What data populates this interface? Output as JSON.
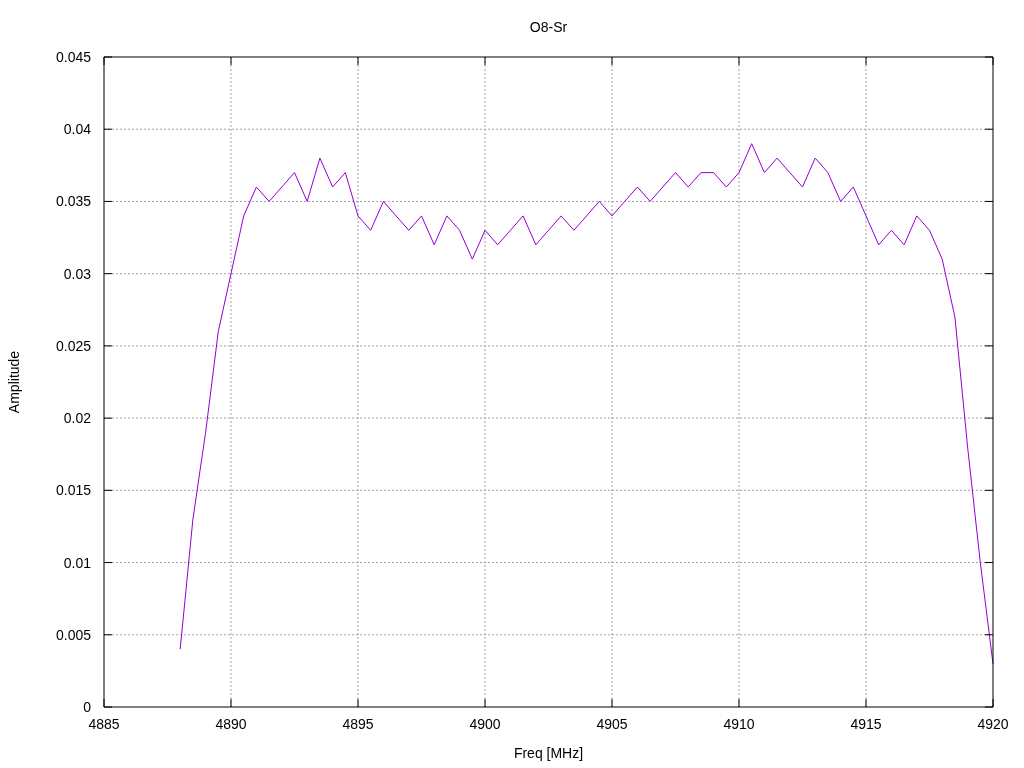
{
  "chart_data": {
    "type": "line",
    "title": "O8-Sr",
    "xlabel": "Freq [MHz]",
    "ylabel": "Amplitude",
    "grid": true,
    "xlim": [
      4885,
      4920
    ],
    "ylim": [
      0,
      0.045
    ],
    "xticks": [
      4885,
      4890,
      4895,
      4900,
      4905,
      4910,
      4915,
      4920
    ],
    "yticks": [
      0,
      0.005,
      0.01,
      0.015,
      0.02,
      0.025,
      0.03,
      0.035,
      0.04,
      0.045
    ],
    "x": [
      4888,
      4888.5,
      4889,
      4889.5,
      4890,
      4890.5,
      4891,
      4891.5,
      4892,
      4892.5,
      4893,
      4893.5,
      4894,
      4894.5,
      4895,
      4895.5,
      4896,
      4896.5,
      4897,
      4897.5,
      4898,
      4898.5,
      4899,
      4899.5,
      4900,
      4900.5,
      4901,
      4901.5,
      4902,
      4902.5,
      4903,
      4903.5,
      4904,
      4904.5,
      4905,
      4905.5,
      4906,
      4906.5,
      4907,
      4907.5,
      4908,
      4908.5,
      4909,
      4909.5,
      4910,
      4910.5,
      4911,
      4911.5,
      4912,
      4912.5,
      4913,
      4913.5,
      4914,
      4914.5,
      4915,
      4915.5,
      4916,
      4916.5,
      4917,
      4917.5,
      4918,
      4918.5,
      4919,
      4919.5,
      4920
    ],
    "series": [
      {
        "color": "#9400d3",
        "values": [
          0.004,
          0.013,
          0.019,
          0.026,
          0.03,
          0.034,
          0.036,
          0.035,
          0.036,
          0.037,
          0.035,
          0.038,
          0.036,
          0.037,
          0.034,
          0.033,
          0.035,
          0.034,
          0.033,
          0.034,
          0.032,
          0.034,
          0.033,
          0.031,
          0.033,
          0.032,
          0.033,
          0.034,
          0.032,
          0.033,
          0.034,
          0.033,
          0.034,
          0.035,
          0.034,
          0.035,
          0.036,
          0.035,
          0.036,
          0.037,
          0.036,
          0.037,
          0.037,
          0.036,
          0.037,
          0.039,
          0.037,
          0.038,
          0.037,
          0.036,
          0.038,
          0.037,
          0.035,
          0.036,
          0.034,
          0.032,
          0.033,
          0.032,
          0.034,
          0.033,
          0.031,
          0.027,
          0.018,
          0.01,
          0.003
        ]
      }
    ]
  }
}
